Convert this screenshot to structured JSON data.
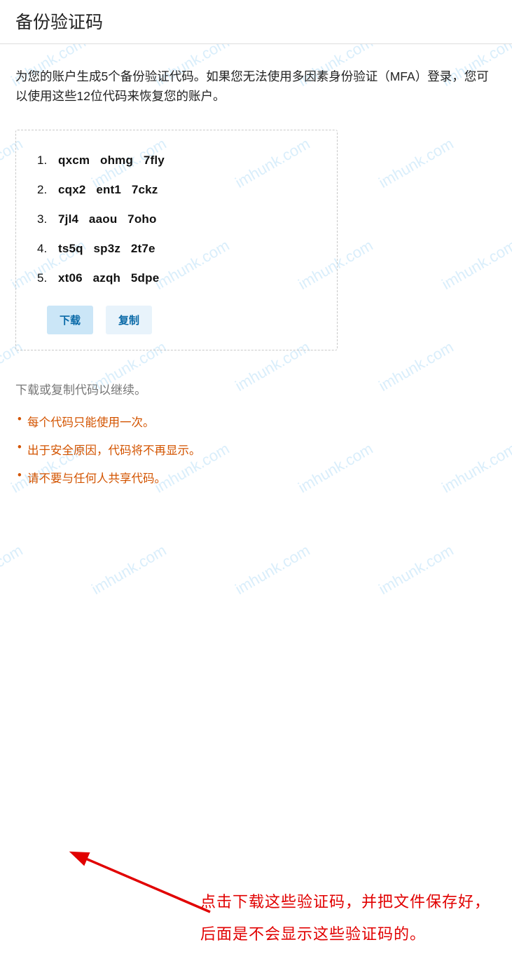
{
  "watermark_text": "imhunk.com",
  "header": {
    "title": "备份验证码"
  },
  "description": "为您的账户生成5个备份验证代码。如果您无法使用多因素身份验证（MFA）登录，您可以使用这些12位代码来恢复您的账户。",
  "codes": [
    "qxcm   ohmg   7fly",
    "cqx2   ent1   7ckz",
    "7jl4   aaou   7oho",
    "ts5q   sp3z   2t7e",
    "xt06   azqh   5dpe"
  ],
  "buttons": {
    "download": "下载",
    "copy": "复制"
  },
  "continue_hint": "下载或复制代码以继续。",
  "notes": [
    "每个代码只能使用一次。",
    "出于安全原因，代码将不再显示。",
    "请不要与任何人共享代码。"
  ],
  "annotation": "点击下载这些验证码，并把文件保存好，后面是不会显示这些验证码的。"
}
